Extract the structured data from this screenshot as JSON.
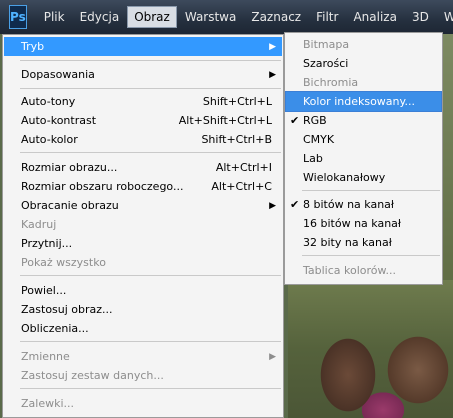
{
  "app": {
    "logo": "Ps"
  },
  "menubar": [
    "Plik",
    "Edycja",
    "Obraz",
    "Warstwa",
    "Zaznacz",
    "Filtr",
    "Analiza",
    "3D",
    "Wido"
  ],
  "menu": {
    "tryb": "Tryb",
    "dopasowania": "Dopasowania",
    "auto_tony": "Auto-tony",
    "auto_tony_sc": "Shift+Ctrl+L",
    "auto_kontrast": "Auto-kontrast",
    "auto_kontrast_sc": "Alt+Shift+Ctrl+L",
    "auto_kolor": "Auto-kolor",
    "auto_kolor_sc": "Shift+Ctrl+B",
    "rozmiar_obrazu": "Rozmiar obrazu...",
    "rozmiar_obrazu_sc": "Alt+Ctrl+I",
    "rozmiar_obszaru": "Rozmiar obszaru roboczego...",
    "rozmiar_obszaru_sc": "Alt+Ctrl+C",
    "obracanie": "Obracanie obrazu",
    "kadruj": "Kadruj",
    "przytnij": "Przytnij...",
    "pokaz": "Pokaż wszystko",
    "powiel": "Powiel...",
    "zastosuj_obraz": "Zastosuj obraz...",
    "obliczenia": "Obliczenia...",
    "zmienne": "Zmienne",
    "zastosuj_zestaw": "Zastosuj zestaw danych...",
    "zalewki": "Zalewki..."
  },
  "submenu": {
    "bitmapa": "Bitmapa",
    "szarosci": "Szarości",
    "bichromia": "Bichromia",
    "kolor_indeks": "Kolor indeksowany...",
    "rgb": "RGB",
    "cmyk": "CMYK",
    "lab": "Lab",
    "wielokanalowy": "Wielokanałowy",
    "b8": "8 bitów na kanał",
    "b16": "16 bitów na kanał",
    "b32": "32 bity na kanał",
    "tablica": "Tablica kolorów...",
    "checked": [
      "RGB",
      "8 bitów na kanał"
    ]
  }
}
